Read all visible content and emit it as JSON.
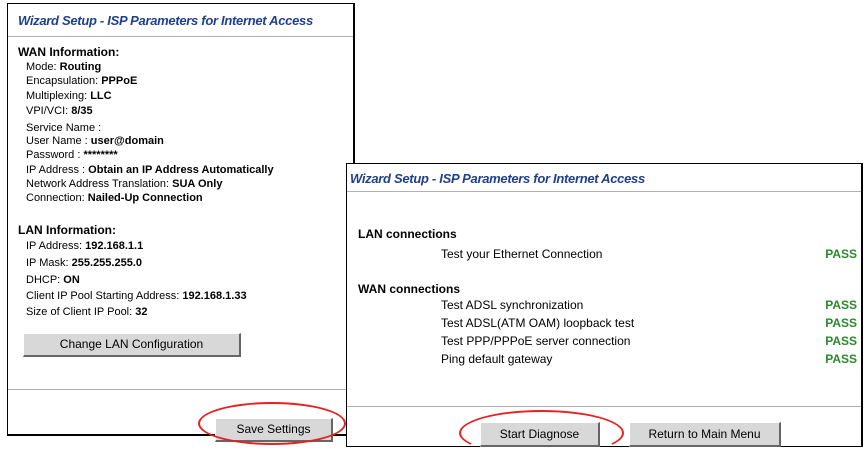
{
  "wizard": {
    "title": "Wizard Setup - ISP Parameters for Internet Access",
    "wan": {
      "heading": "WAN Information:",
      "rows": [
        {
          "label": "Mode: ",
          "value": "Routing"
        },
        {
          "label": "Encapsulation: ",
          "value": "PPPoE"
        },
        {
          "label": "Multiplexing: ",
          "value": "LLC"
        },
        {
          "label": "VPI/VCI: ",
          "value": "8/35"
        },
        {
          "label": "Service Name :",
          "value": ""
        },
        {
          "label": "User Name : ",
          "value": "user@domain"
        },
        {
          "label": "Password : ",
          "value": "********"
        },
        {
          "label": "IP Address : ",
          "value": "Obtain an IP Address Automatically"
        },
        {
          "label": "Network Address Translation: ",
          "value": "SUA Only"
        },
        {
          "label": "Connection: ",
          "value": "Nailed-Up Connection"
        }
      ]
    },
    "lan": {
      "heading": "LAN Information:",
      "rows": [
        {
          "label": "IP Address: ",
          "value": "192.168.1.1"
        },
        {
          "label": "IP Mask: ",
          "value": "255.255.255.0"
        },
        {
          "label": "DHCP: ",
          "value": "ON"
        },
        {
          "label": "Client IP Pool Starting Address: ",
          "value": "192.168.1.33"
        },
        {
          "label": "Size of Client IP Pool: ",
          "value": "32"
        }
      ]
    },
    "change_lan_label": "Change LAN Configuration",
    "save_label": "Save Settings"
  },
  "diagnose": {
    "title": "Wizard Setup - ISP Parameters for Internet Access",
    "lan_heading": "LAN connections",
    "lan_tests": [
      {
        "name": "Test your Ethernet Connection",
        "result": "PASS"
      }
    ],
    "wan_heading": "WAN connections",
    "wan_tests": [
      {
        "name": "Test ADSL synchronization",
        "result": "PASS"
      },
      {
        "name": "Test ADSL(ATM OAM) loopback test",
        "result": "PASS"
      },
      {
        "name": "Test PPP/PPPoE server connection",
        "result": "PASS"
      },
      {
        "name": "Ping default gateway",
        "result": "PASS"
      }
    ],
    "start_label": "Start Diagnose",
    "return_label": "Return to Main Menu"
  },
  "colors": {
    "title": "#1f3f8f",
    "pass": "#2a8a2a",
    "highlight_oval": "#e52222"
  }
}
